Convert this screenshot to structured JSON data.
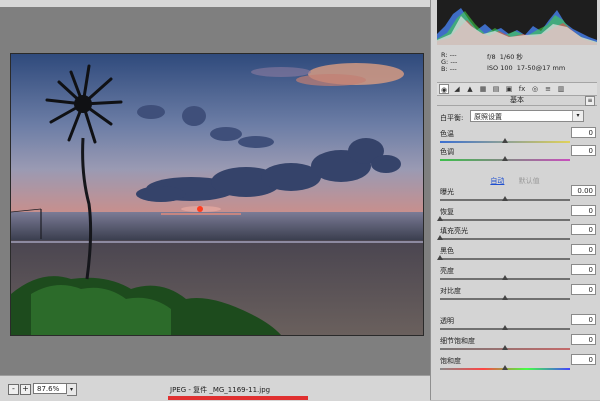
{
  "canvas": {
    "zoom_value": "87.6%",
    "zoom_out_label": "-",
    "zoom_in_label": "+",
    "file_label": "JPEG - 复件 _MG_1169-11.jpg"
  },
  "camera_info": {
    "r": "R:",
    "g": "G:",
    "b": "B:",
    "dashes": "---",
    "aperture": "f/8",
    "shutter": "1/60 秒",
    "iso": "ISO 100",
    "lens": "17-50@17 mm"
  },
  "panel": {
    "section_title": "基本",
    "white_balance_label": "白平衡:",
    "white_balance_value": "原照设置",
    "auto_label": "自动",
    "default_label": "默认值",
    "sliders": [
      {
        "label": "色温",
        "value": "0",
        "position": 0.5
      },
      {
        "label": "色调",
        "value": "0",
        "position": 0.5
      },
      {
        "label": "曝光",
        "value": "0.00",
        "position": 0.5
      },
      {
        "label": "恢复",
        "value": "0",
        "position": 0.0
      },
      {
        "label": "填充亮光",
        "value": "0",
        "position": 0.0
      },
      {
        "label": "黑色",
        "value": "0",
        "position": 0.0
      },
      {
        "label": "亮度",
        "value": "0",
        "position": 0.5
      },
      {
        "label": "对比度",
        "value": "0",
        "position": 0.5
      },
      {
        "label": "透明",
        "value": "0",
        "position": 0.5
      },
      {
        "label": "细节饱和度",
        "value": "0",
        "position": 0.5
      },
      {
        "label": "饱和度",
        "value": "0",
        "position": 0.5
      }
    ]
  },
  "colors": {
    "accent_link": "#1f4fcf"
  }
}
